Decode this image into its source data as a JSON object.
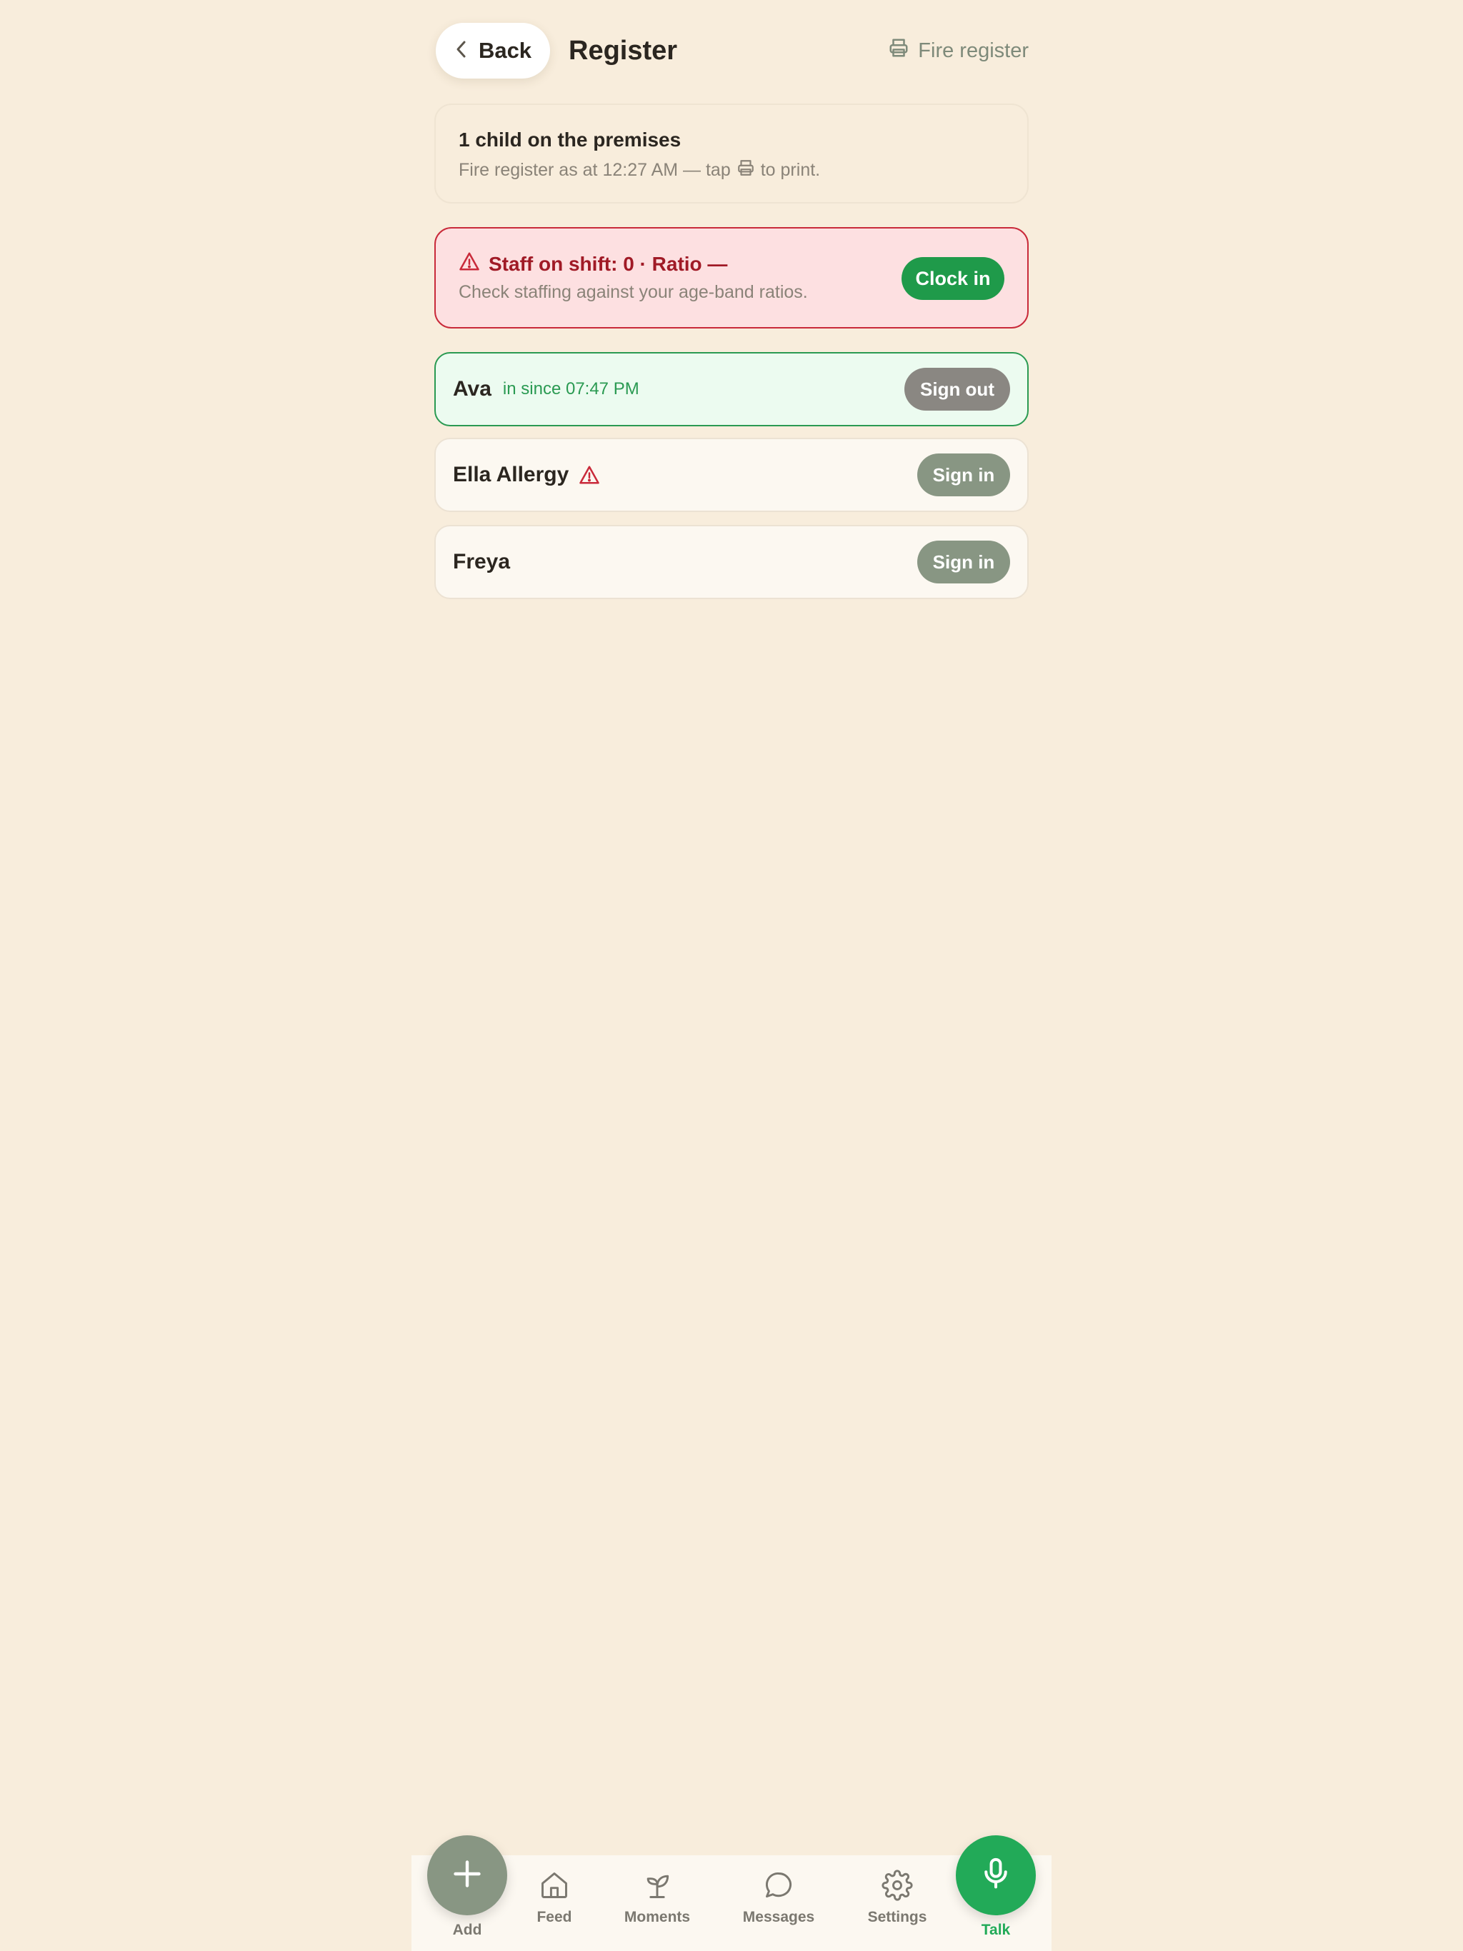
{
  "header": {
    "back_label": "Back",
    "title": "Register",
    "fire_register_label": "Fire register"
  },
  "summary": {
    "title": "1 child on the premises",
    "subtitle_before": "Fire register as at 12:27 AM — tap",
    "subtitle_after": "to print."
  },
  "staff_alert": {
    "title": "Staff on shift: 0 · Ratio —",
    "subtitle": "Check staffing against your age-band ratios.",
    "clock_in_label": "Clock in"
  },
  "children": [
    {
      "name": "Ava",
      "status": "in since 07:47 PM",
      "action": "Sign out"
    },
    {
      "name": "Ella Allergy",
      "action": "Sign in"
    },
    {
      "name": "Freya",
      "action": "Sign in"
    }
  ],
  "nav": {
    "add": "Add",
    "feed": "Feed",
    "moments": "Moments",
    "messages": "Messages",
    "settings": "Settings",
    "talk": "Talk"
  },
  "colors": {
    "background": "#f8eddc",
    "accent_green": "#22aa58",
    "alert_red": "#c92a3a",
    "sage": "#889683"
  },
  "icons": [
    "chevron-left-icon",
    "printer-icon",
    "warning-icon",
    "plus-icon",
    "home-icon",
    "sprout-icon",
    "chat-bubble-icon",
    "gear-icon",
    "microphone-icon"
  ]
}
